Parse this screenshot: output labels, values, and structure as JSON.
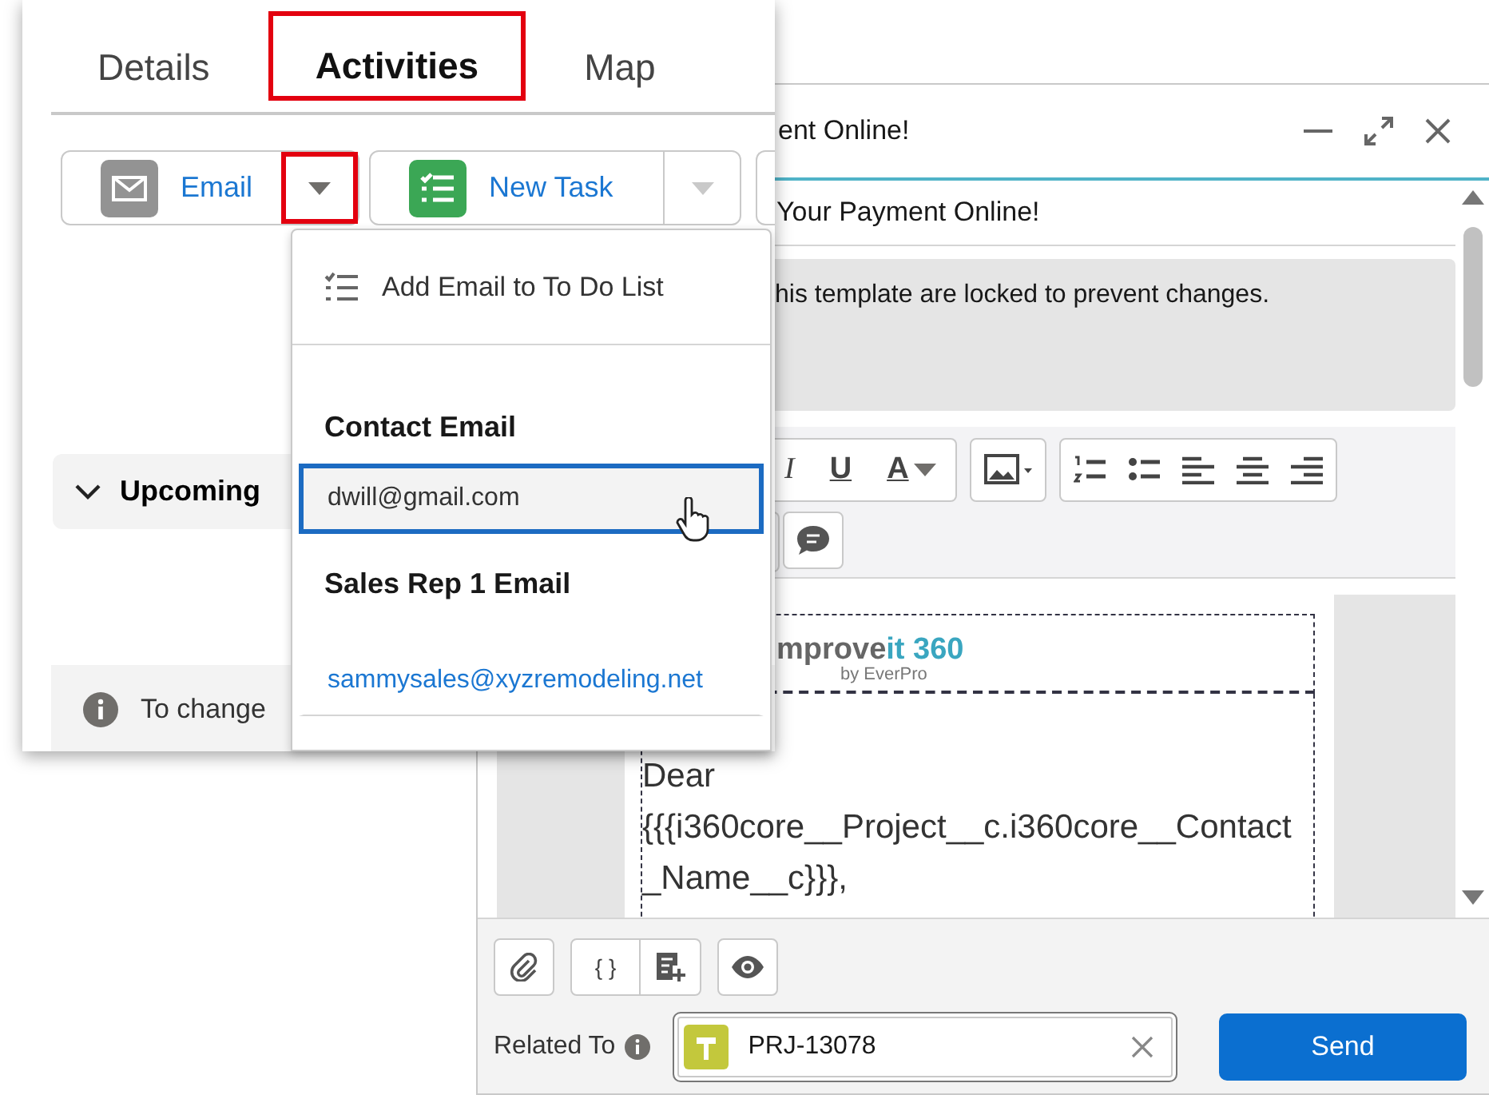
{
  "activity_panel": {
    "tabs": [
      {
        "label": "Details",
        "selected": false,
        "annotated": false
      },
      {
        "label": "Activities",
        "selected": true,
        "annotated": true
      },
      {
        "label": "Map",
        "selected": false,
        "annotated": false
      }
    ],
    "actions": [
      {
        "label": "Email",
        "kind": "email",
        "annotated": true
      },
      {
        "label": "New Task",
        "kind": "task",
        "annotated": false
      }
    ],
    "section": {
      "label": "Upcoming",
      "expanded": true
    },
    "notice": "To change"
  },
  "email_menu": {
    "items": [
      {
        "kind": "action",
        "label": "Add Email to To Do List"
      },
      {
        "kind": "header",
        "label": "Contact Email"
      },
      {
        "kind": "address",
        "label": "dwill@gmail.com",
        "selected": true
      },
      {
        "kind": "header",
        "label": "Sales Rep 1 Email"
      },
      {
        "kind": "address",
        "label": "sammysales@xyzremodeling.net",
        "selected": false
      }
    ]
  },
  "composer": {
    "title": "ent Online!",
    "subject": "Your Payment Online!",
    "notice": "his template are locked to prevent changes.",
    "format_buttons": [
      "I",
      "U",
      "A"
    ],
    "logo": {
      "name": "mprove",
      "accent": "it 360",
      "tagline": "by EverPro"
    },
    "body": "Dear {{{i360core__Project__c.i360core__Contact_Name__c}}},",
    "merge_button": "{ }",
    "related_label": "Related To",
    "related_value": "PRJ-13078",
    "send": "Send"
  }
}
